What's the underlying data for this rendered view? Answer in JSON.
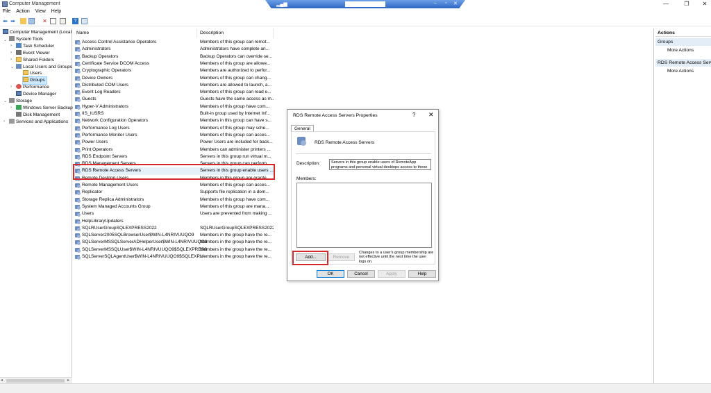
{
  "window": {
    "title": "Computer Management"
  },
  "menu": [
    "File",
    "Action",
    "View",
    "Help"
  ],
  "tree": [
    {
      "label": "Computer Management (Local",
      "level": 0
    },
    {
      "label": "System Tools",
      "level": 1
    },
    {
      "label": "Task Scheduler",
      "level": 2
    },
    {
      "label": "Event Viewer",
      "level": 2
    },
    {
      "label": "Shared Folders",
      "level": 2
    },
    {
      "label": "Local Users and Groups",
      "level": 2
    },
    {
      "label": "Users",
      "level": 3
    },
    {
      "label": "Groups",
      "level": 3
    },
    {
      "label": "Performance",
      "level": 2
    },
    {
      "label": "Device Manager",
      "level": 2
    },
    {
      "label": "Storage",
      "level": 1
    },
    {
      "label": "Windows Server Backup",
      "level": 2
    },
    {
      "label": "Disk Management",
      "level": 2
    },
    {
      "label": "Services and Applications",
      "level": 1
    }
  ],
  "list": {
    "col_name": "Name",
    "col_desc": "Description",
    "rows": [
      [
        "Access Control Assistance Operators",
        "Members of this group can remot..."
      ],
      [
        "Administrators",
        "Administrators have complete an..."
      ],
      [
        "Backup Operators",
        "Backup Operators can override se..."
      ],
      [
        "Certificate Service DCOM Access",
        "Members of this group are allowe..."
      ],
      [
        "Cryptographic Operators",
        "Members are authorized to perfor..."
      ],
      [
        "Device Owners",
        "Members of this group can chang..."
      ],
      [
        "Distributed COM Users",
        "Members are allowed to launch, a..."
      ],
      [
        "Event Log Readers",
        "Members of this group can read e..."
      ],
      [
        "Guests",
        "Guests have the same access as m..."
      ],
      [
        "Hyper-V Administrators",
        "Members of this group have com..."
      ],
      [
        "IIS_IUSRS",
        "Built-in group used by Internet Inf..."
      ],
      [
        "Network Configuration Operators",
        "Members in this group can have s..."
      ],
      [
        "Performance Log Users",
        "Members of this group may sche..."
      ],
      [
        "Performance Monitor Users",
        "Members of this group can acces..."
      ],
      [
        "Power Users",
        "Power Users are included for back..."
      ],
      [
        "Print Operators",
        "Members can administer printers ..."
      ],
      [
        "RDS Endpoint Servers",
        "Servers in this group run virtual m..."
      ],
      [
        "RDS Management Servers",
        "Servers in this group can perform..."
      ],
      [
        "RDS Remote Access Servers",
        "Servers in this group enable users ..."
      ],
      [
        "Remote Desktop Users",
        "Members in this group are grante..."
      ],
      [
        "Remote Management Users",
        "Members of this group can acces..."
      ],
      [
        "Replicator",
        "Supports file replication in a dom..."
      ],
      [
        "Storage Replica Administrators",
        "Members of this group have com..."
      ],
      [
        "System Managed Accounts Group",
        "Members of this group are mana..."
      ],
      [
        "Users",
        "Users are prevented from making ..."
      ],
      [
        "HelpLibraryUpdaters",
        ""
      ],
      [
        "SQLRUserGroupSQLEXPRESS2022",
        "SQLRUserGroupSQLEXPRESS2022"
      ],
      [
        "SQLServer2005SQLBrowserUser$WIN-L4NRIVUUQO9",
        "Members in the group have the re..."
      ],
      [
        "SQLServerMSSQLServerADHelperUser$WIN-L4NRIVUUQO9",
        "Members in the group have the re..."
      ],
      [
        "SQLServerMSSQLUser$WIN-L4NRIVUUQO9$SQLEXPRESS",
        "Members in the group have the re..."
      ],
      [
        "SQLServerSQLAgentUser$WIN-L4NRIVUUQO9$SQLEXP...",
        "Members in the group have the re..."
      ]
    ]
  },
  "actions": {
    "header": "Actions",
    "section1": "Groups",
    "item1": "More Actions",
    "section2": "RDS Remote Access Servers",
    "item2": "More Actions"
  },
  "dialog": {
    "title": "RDS Remote Access Servers Properties",
    "help_glyph": "?",
    "close_glyph": "✕",
    "tab": "General",
    "group_name": "RDS Remote Access Servers",
    "desc_label": "Description:",
    "desc_value": "Servers in this group enable users of RemoteApp programs and personal virtual desktops access to these",
    "members_label": "Members:",
    "add": "Add...",
    "remove": "Remove",
    "note": "Changes to a user's group membership are not effective until the next time the user logs on.",
    "ok": "OK",
    "cancel": "Cancel",
    "apply": "Apply",
    "help": "Help"
  }
}
